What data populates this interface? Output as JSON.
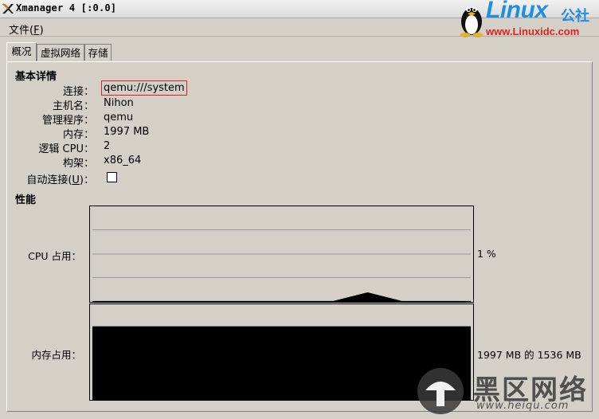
{
  "window": {
    "title": "Xmanager 4 [:0.0]"
  },
  "logo": {
    "brand": "Linux",
    "brand_cn": "公社",
    "url": "www.Linuxidc.com"
  },
  "menu": {
    "file": "文件(",
    "file_key": "F",
    "file_end": ")"
  },
  "tabs": [
    "概况",
    "虚拟网络",
    "存储"
  ],
  "basic": {
    "title": "基本详情",
    "rows": [
      {
        "label": "连接：",
        "value": "qemu:///system"
      },
      {
        "label": "主机名：",
        "value": "Nihon"
      },
      {
        "label": "管理程序：",
        "value": "qemu"
      },
      {
        "label": "内存：",
        "value": "1997 MB"
      },
      {
        "label": "逻辑 CPU：",
        "value": "2"
      },
      {
        "label": "构架：",
        "value": "x86_64"
      }
    ],
    "autoconnect": {
      "label": "自动连接(",
      "key": "U",
      "end": ")：",
      "checked": false
    }
  },
  "perf": {
    "title": "性能",
    "cpu": {
      "label": "CPU 占用：",
      "value": "1 %",
      "history_percent": [
        1,
        1,
        1,
        1,
        1,
        1,
        1,
        1,
        10,
        1,
        1,
        1
      ]
    },
    "memory": {
      "label": "内存占用：",
      "value": "1997 MB 的 1536 MB",
      "fraction": 0.77
    }
  },
  "watermark": {
    "text": "黑区网络",
    "url": "www.heiqu.com"
  },
  "colors": {
    "accent": "#e02020",
    "brand_blue": "#1e8fe0",
    "background": "#d4d0c8"
  }
}
